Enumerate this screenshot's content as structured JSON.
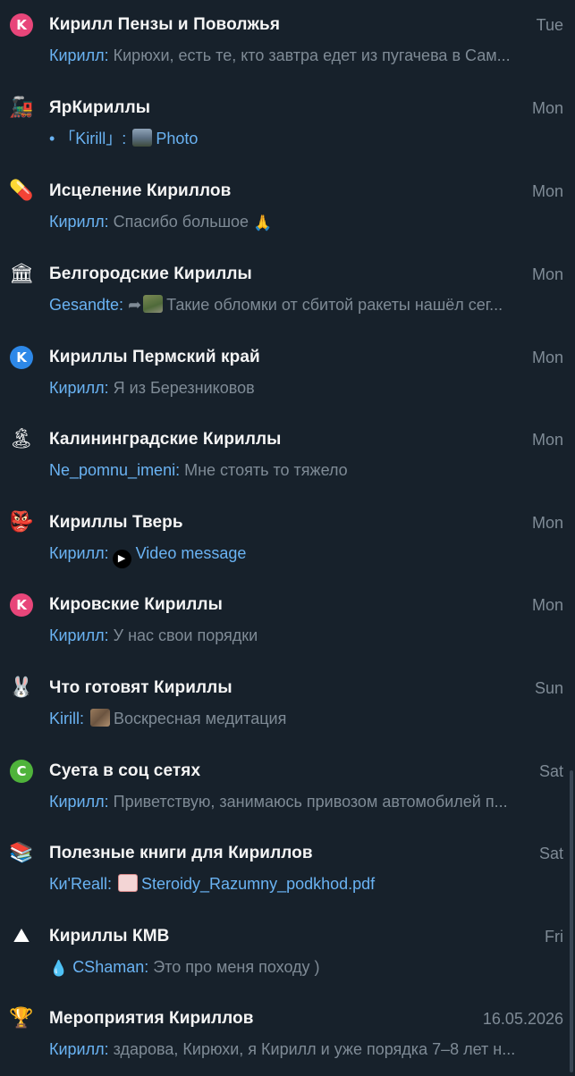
{
  "accent_color": "#6ab3f3",
  "background_color": "#17212b",
  "chats": [
    {
      "title": "Кирилл Пензы и Поволжья",
      "time": "Tue",
      "avatar_letter": "K",
      "avatar_color": "#e8467a",
      "sender": "Кирилл:",
      "text": "Кирюхи, есть те, кто завтра едет из пугачева в Сам..."
    },
    {
      "title": "ЯрКириллы",
      "time": "Mon",
      "avatar_icon": "train-icon",
      "avatar_glyph": "🚂",
      "sender": "• 「Kirill」:",
      "media_label": "Photo",
      "media_icon": "photo-thumbnail-icon"
    },
    {
      "title": "Исцеление Кириллов",
      "time": "Mon",
      "avatar_icon": "pill-icon",
      "avatar_glyph": "💊",
      "sender": "Кирилл:",
      "text": "Спасибо большое",
      "trailing_glyph": "🙏",
      "trailing_icon": "praying-hands-icon"
    },
    {
      "title": "Белгородские Кириллы",
      "time": "Mon",
      "avatar_icon": "classical-building-icon",
      "avatar_glyph": "🏛",
      "sender": "Gesandte:",
      "forward_icon": "forward-arrow-icon",
      "text": "Такие обломки от сбитой ракеты нашёл сег..."
    },
    {
      "title": "Кириллы Пермский край",
      "time": "Mon",
      "avatar_letter": "K",
      "avatar_color": "#2d88e8",
      "sender": "Кирилл:",
      "text": "Я из Березниковов"
    },
    {
      "title": "Калининградские Кириллы",
      "time": "Mon",
      "avatar_icon": "desert-island-icon",
      "avatar_glyph": "🏝",
      "sender": "Ne_pomnu_imeni:",
      "text": "Мне стоять то тяжело"
    },
    {
      "title": "Кириллы Тверь",
      "time": "Mon",
      "avatar_icon": "character-avatar-icon",
      "avatar_glyph": "👺",
      "sender": "Кирилл:",
      "media_label": "Video message",
      "media_icon": "video-message-play-icon"
    },
    {
      "title": "Кировские Кириллы",
      "time": "Mon",
      "avatar_letter": "K",
      "avatar_color": "#e8467a",
      "sender": "Кирилл:",
      "text": "У нас свои порядки"
    },
    {
      "title": "Что готовят Кириллы",
      "time": "Sun",
      "avatar_icon": "bunny-icon",
      "avatar_glyph": "🐰",
      "sender": "Kirill:",
      "text": "Воскресная медитация",
      "thumb_icon": "image-thumbnail-icon"
    },
    {
      "title": "Суета в соц сетях",
      "time": "Sat",
      "avatar_letter": "C",
      "avatar_color": "#4fb33b",
      "sender": "Кирилл:",
      "text": "Приветствую, занимаюсь привозом автомобилей п..."
    },
    {
      "title": "Полезные книги для Кириллов",
      "time": "Sat",
      "avatar_icon": "books-icon",
      "avatar_glyph": "📚",
      "sender": "Ки'Reall:",
      "media_label": "Steroidy_Razumny_podkhod.pdf",
      "media_icon": "pdf-thumbnail-icon"
    },
    {
      "title": "Кириллы КМВ",
      "time": "Fri",
      "avatar_icon": "mountain-icon",
      "avatar_glyph": "⛰",
      "sender_prefix_glyph": "💧",
      "sender": "CShaman:",
      "text": "Это про меня походу )"
    },
    {
      "title": "Мероприятия Кириллов",
      "time": "16.05.2026",
      "avatar_icon": "trophy-icon",
      "avatar_glyph": "🏆",
      "sender": "Кирилл:",
      "text": "здарова, Кирюхи, я Кирилл и уже порядка 7–8 лет н..."
    }
  ]
}
